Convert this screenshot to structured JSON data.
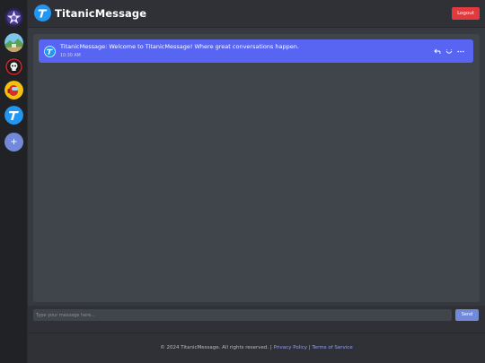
{
  "header": {
    "brand": "TitanicMessage",
    "logout_label": "Logout"
  },
  "sidebar": {
    "servers": [
      {
        "icon": "purple-star-server-icon"
      },
      {
        "icon": "landscape-server-icon"
      },
      {
        "icon": "skull-server-icon"
      },
      {
        "icon": "red-crewmate-server-icon"
      },
      {
        "icon": "titanic-logo-server-icon"
      }
    ],
    "add_label": "+"
  },
  "messages": [
    {
      "text": "TitanicMessage: Welcome to TitanicMessage! Where great conversations happen.",
      "time": "10:30 AM"
    }
  ],
  "composer": {
    "placeholder": "Type your message here...",
    "send_label": "Send"
  },
  "footer": {
    "copyright": "© 2024 TitanicMessage. All rights reserved. |",
    "privacy": "Privacy Policy",
    "separator": "|",
    "terms": "Terms of Service"
  },
  "colors": {
    "accent": "#5865f2",
    "logout": "#e0393e",
    "send": "#7289da",
    "logo": "#2196f3"
  }
}
